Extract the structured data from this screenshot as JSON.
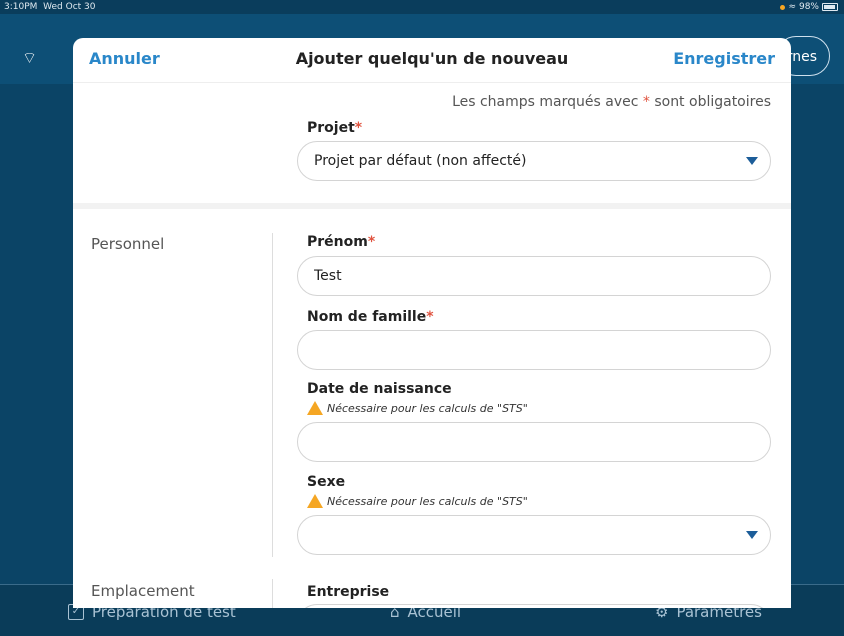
{
  "status": {
    "time": "3:10PM",
    "date": "Wed Oct 30",
    "battery": "98%"
  },
  "background": {
    "pill_text": "rnes",
    "tabs": [
      {
        "label": "Préparation de test",
        "icon": "checkbox-icon"
      },
      {
        "label": "Accueil",
        "icon": "home-icon"
      },
      {
        "label": "Paramètres",
        "icon": "gear-icon"
      }
    ]
  },
  "modal": {
    "cancel": "Annuler",
    "title": "Ajouter quelqu'un de nouveau",
    "save": "Enregistrer",
    "required_note_pre": "Les champs marqués avec",
    "required_star": "*",
    "required_note_post": "sont obligatoires",
    "project": {
      "label": "Projet",
      "value": "Projet par défaut (non affecté)"
    },
    "sections": {
      "personnel": "Personnel",
      "location": "Emplacement"
    },
    "first_name": {
      "label": "Prénom",
      "value": "Test"
    },
    "last_name": {
      "label": "Nom de famille",
      "value": ""
    },
    "birth_date": {
      "label": "Date de naissance",
      "hint": "Nécessaire pour les calculs de \"STS\"",
      "value": ""
    },
    "sex": {
      "label": "Sexe",
      "hint": "Nécessaire pour les calculs de \"STS\"",
      "value": ""
    },
    "company": {
      "label": "Entreprise"
    }
  }
}
